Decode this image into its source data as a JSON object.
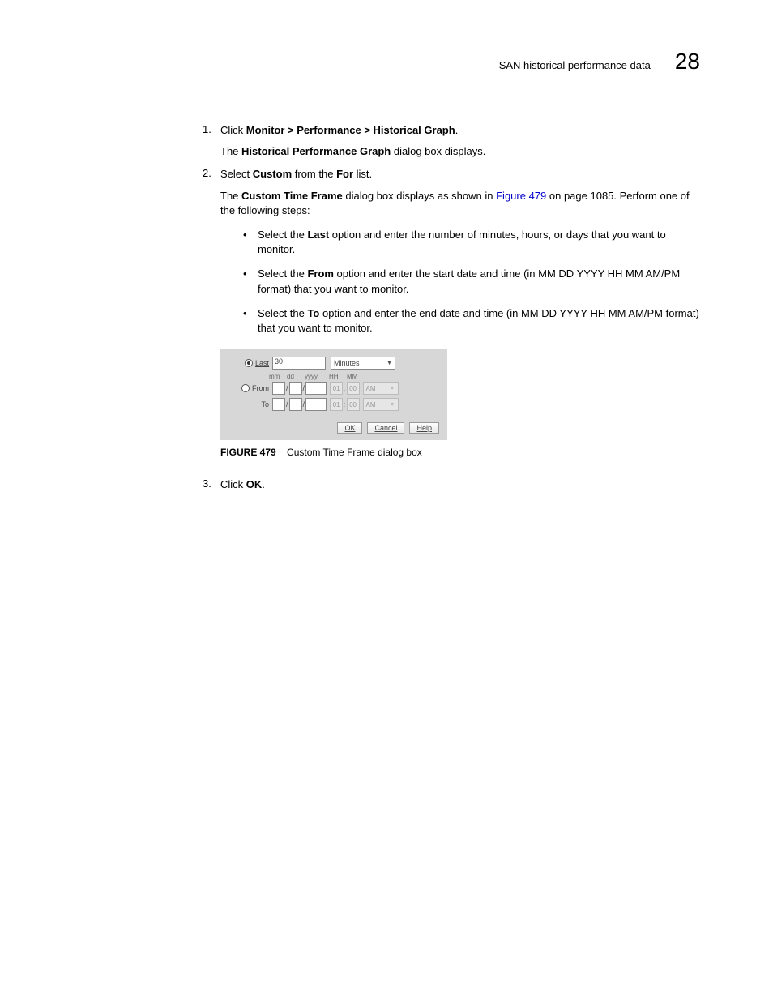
{
  "header": {
    "title": "SAN historical performance data",
    "chapter": "28"
  },
  "steps": {
    "s1": {
      "num": "1.",
      "prefix": "Click ",
      "bold": "Monitor > Performance > Historical Graph",
      "suffix": ".",
      "body_pre": "The ",
      "body_bold": "Historical Performance Graph",
      "body_post": " dialog box displays."
    },
    "s2": {
      "num": "2.",
      "p1": "Select ",
      "p1b": "Custom",
      "p2": " from the ",
      "p2b": "For",
      "p3": " list.",
      "body_pre": "The ",
      "body_bold": "Custom Time Frame",
      "body_mid": " dialog box displays as shown in ",
      "body_link": "Figure 479",
      "body_post": " on page 1085. Perform one of the following steps:"
    },
    "s3": {
      "num": "3.",
      "p1": "Click ",
      "p1b": "OK",
      "p2": "."
    }
  },
  "bullets": {
    "b1": {
      "pre": "Select the ",
      "bold": "Last",
      "post": " option and enter the number of minutes, hours, or days that you want to monitor."
    },
    "b2": {
      "pre": "Select the ",
      "bold": "From",
      "post": " option and enter the start date and time (in MM DD YYYY HH MM AM/PM format) that you want to monitor."
    },
    "b3": {
      "pre": "Select the ",
      "bold": "To",
      "post": " option and enter the end date and time (in MM DD YYYY HH MM AM/PM format) that you want to monitor."
    }
  },
  "dialog": {
    "last_label": "Last",
    "last_value": "30",
    "unit": "Minutes",
    "hdr_mm": "mm",
    "hdr_dd": "dd",
    "hdr_yyyy": "yyyy",
    "hdr_HH": "HH",
    "hdr_MM": "MM",
    "from_label": "From",
    "to_label": "To",
    "hh_ph": "01",
    "mm_ph": "00",
    "ampm": "AM",
    "slash": "/",
    "colon": ":",
    "ok": "OK",
    "cancel": "Cancel",
    "help": "Help"
  },
  "figure": {
    "label": "FIGURE 479",
    "caption": "Custom Time Frame dialog box"
  }
}
